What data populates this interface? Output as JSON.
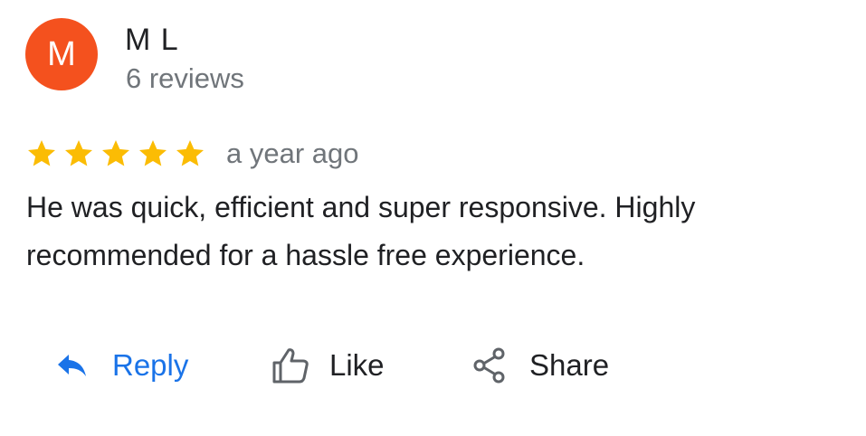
{
  "reviewer": {
    "avatar_initial": "M",
    "avatar_color": "#f4511e",
    "name": "M L",
    "review_count": "6 reviews"
  },
  "review": {
    "rating": 5,
    "rating_max": 5,
    "star_color": "#fbbc04",
    "time_ago": "a year ago",
    "text": "He was quick, efficient and super responsive. Highly recommended for a hassle free experience."
  },
  "actions": {
    "reply": {
      "label": "Reply",
      "icon": "reply-arrow-icon",
      "color": "#1a73e8"
    },
    "like": {
      "label": "Like",
      "icon": "thumbs-up-icon"
    },
    "share": {
      "label": "Share",
      "icon": "share-icon"
    }
  }
}
